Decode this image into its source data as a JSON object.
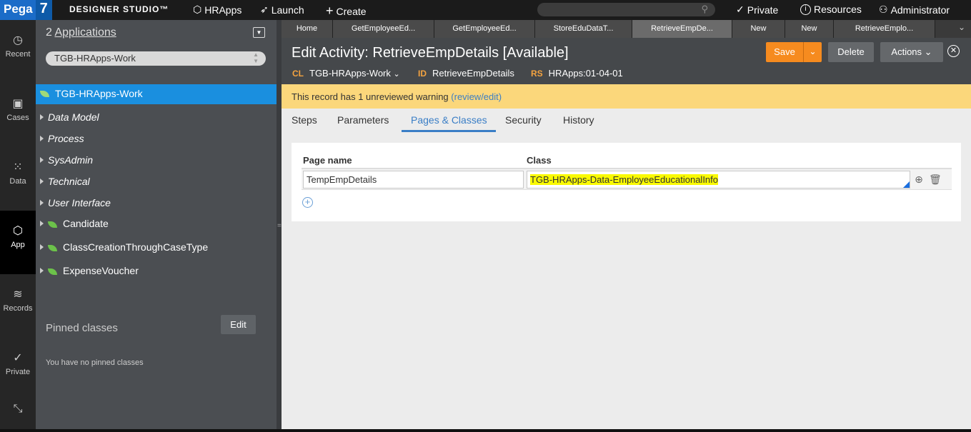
{
  "topbar": {
    "logo_pega": "Pega",
    "logo_version": "7",
    "studio": "DESIGNER STUDIO™",
    "app": "HRApps",
    "launch": "Launch",
    "create": "Create",
    "search_placeholder": "",
    "private": "Private",
    "resources": "Resources",
    "user": "Administrator"
  },
  "rail": [
    {
      "label": "Recent",
      "icon": "clock-icon"
    },
    {
      "label": "Cases",
      "icon": "briefcase-icon"
    },
    {
      "label": "Data",
      "icon": "grid-icon"
    },
    {
      "label": "App",
      "icon": "cube-icon"
    },
    {
      "label": "Records",
      "icon": "layers-icon"
    },
    {
      "label": "Private",
      "icon": "check-icon"
    }
  ],
  "explorer": {
    "app_count": "2",
    "applications_label": "Applications",
    "app_select": "TGB-HRApps-Work",
    "selected_class": "TGB-HRApps-Work",
    "tree": [
      {
        "label": "Data Model",
        "italic": true
      },
      {
        "label": "Process",
        "italic": true
      },
      {
        "label": "SysAdmin",
        "italic": true
      },
      {
        "label": "Technical",
        "italic": true
      },
      {
        "label": "User Interface",
        "italic": true
      },
      {
        "label": "Candidate",
        "italic": false
      },
      {
        "label": "ClassCreationThroughCaseType",
        "italic": false
      },
      {
        "label": "ExpenseVoucher",
        "italic": false
      }
    ],
    "pinned_title": "Pinned classes",
    "pinned_edit": "Edit",
    "pinned_empty": "You have no pinned classes"
  },
  "tabs": [
    "Home",
    "GetEmployeeEd...",
    "GetEmployeeEd...",
    "StoreEduDataT...",
    "RetrieveEmpDe...",
    "New",
    "New",
    "RetrieveEmplo..."
  ],
  "header": {
    "title": "Edit Activity: RetrieveEmpDetails [Available]",
    "cl_key": "CL",
    "cl_value": "TGB-HRApps-Work",
    "id_key": "ID",
    "id_value": "RetrieveEmpDetails",
    "rs_key": "RS",
    "rs_value": "HRApps:01-04-01",
    "save": "Save",
    "delete": "Delete",
    "actions": "Actions"
  },
  "warning": {
    "text": "This record has 1 unreviewed warning",
    "link": "(review/edit)"
  },
  "content_tabs": [
    "Steps",
    "Parameters",
    "Pages & Classes",
    "Security",
    "History"
  ],
  "table": {
    "col_page": "Page name",
    "col_class": "Class",
    "rows": [
      {
        "page": "TempEmpDetails",
        "class": "TGB-HRApps-Data-EmployeeEducationalInfo"
      }
    ]
  },
  "colors": {
    "accent": "#1a8fdf",
    "save": "#f68b1f",
    "warning_bg": "#fbd77b",
    "highlight": "#fafa00"
  }
}
